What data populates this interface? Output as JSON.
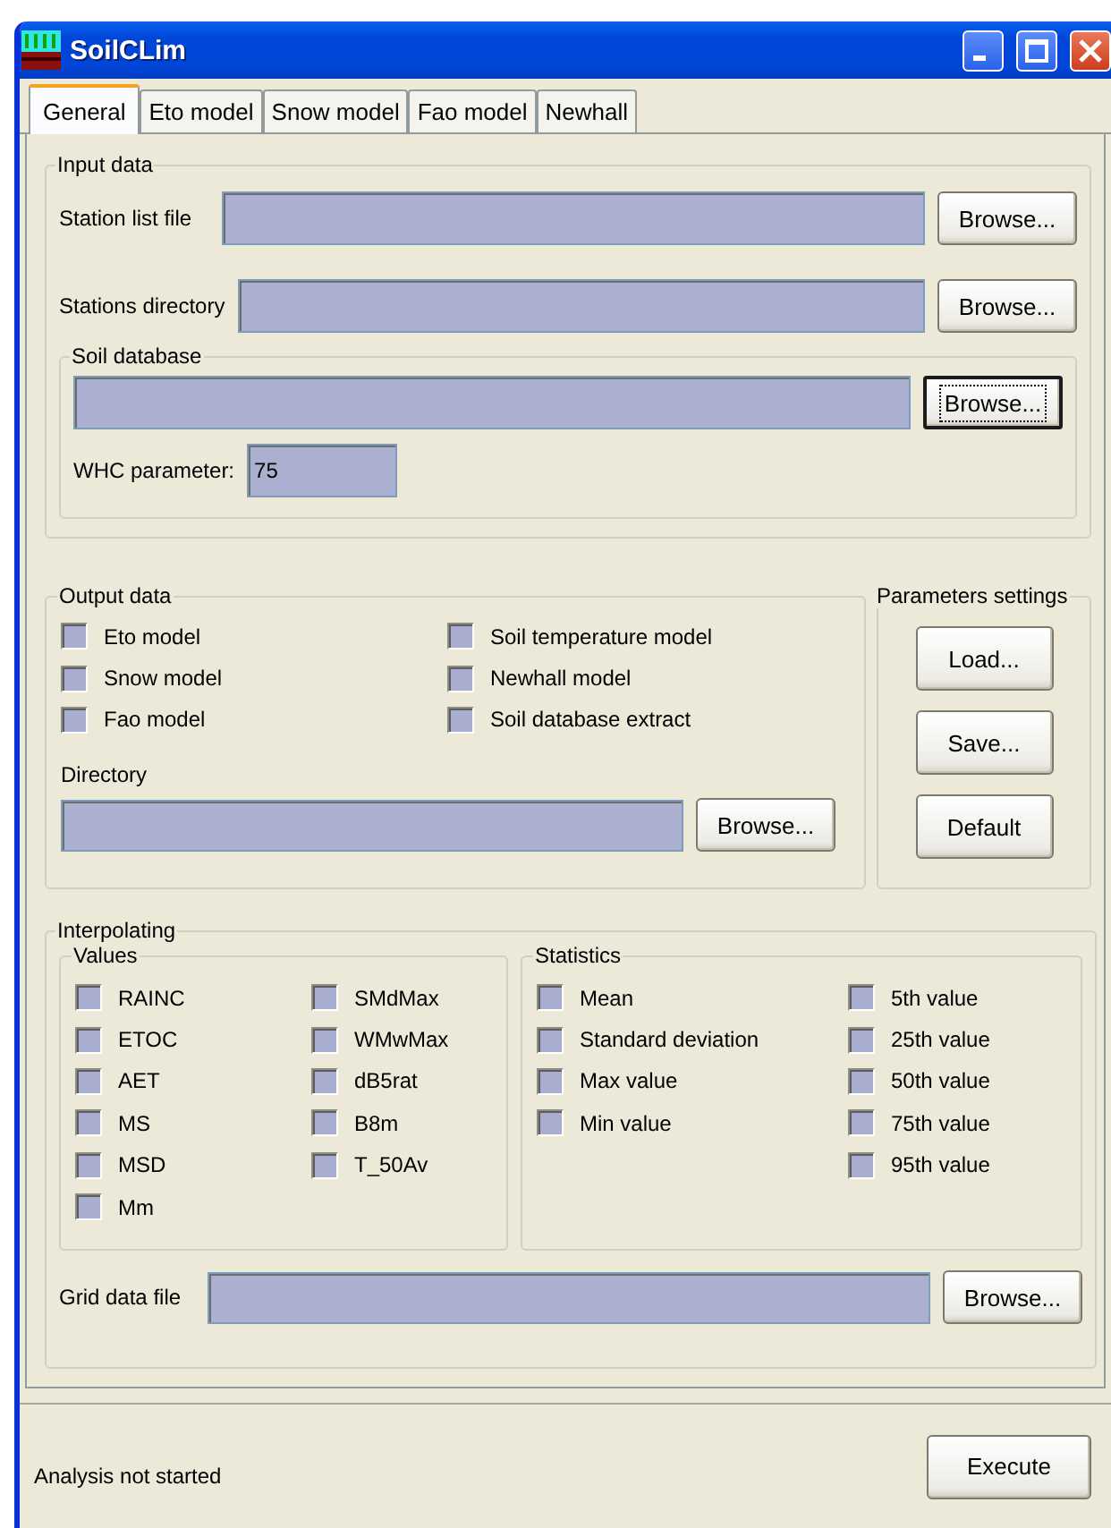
{
  "window": {
    "title": "SoilCLim"
  },
  "tabs": [
    {
      "label": "General",
      "selected": true
    },
    {
      "label": "Eto model",
      "selected": false
    },
    {
      "label": "Snow model",
      "selected": false
    },
    {
      "label": "Fao model",
      "selected": false
    },
    {
      "label": "Newhall",
      "selected": false
    }
  ],
  "input_data": {
    "title": "Input data",
    "station_list_file": {
      "label": "Station list file",
      "button": {
        "label": "Browse...",
        "focused": false
      }
    },
    "stations_directory": {
      "label": "Stations directory",
      "button": {
        "label": "Browse...",
        "focused": false
      }
    },
    "soil_database": {
      "title": "Soil database",
      "button": {
        "label": "Browse...",
        "focused": true
      },
      "whc_parameter": {
        "label": "WHC parameter:",
        "value": "75"
      }
    }
  },
  "output_data": {
    "title": "Output data",
    "options": [
      {
        "label": "Eto model",
        "checked": false
      },
      {
        "label": "Snow model",
        "checked": false
      },
      {
        "label": "Fao model",
        "checked": false
      },
      {
        "label": "Soil temperature model",
        "checked": false
      },
      {
        "label": "Newhall model",
        "checked": false
      },
      {
        "label": "Soil database extract",
        "checked": false
      }
    ],
    "directory": {
      "label": "Directory",
      "button": {
        "label": "Browse...",
        "focused": false
      }
    }
  },
  "parameters_settings": {
    "title": "Parameters settings",
    "buttons": [
      {
        "label": "Load...",
        "focused": false
      },
      {
        "label": "Save...",
        "focused": false
      },
      {
        "label": "Default",
        "focused": false
      }
    ]
  },
  "interpolating": {
    "title": "Interpolating",
    "values": {
      "title": "Values",
      "items": [
        {
          "label": "RAINC",
          "checked": false
        },
        {
          "label": "ETOC",
          "checked": false
        },
        {
          "label": "AET",
          "checked": false
        },
        {
          "label": "MS",
          "checked": false
        },
        {
          "label": "MSD",
          "checked": false
        },
        {
          "label": "Mm",
          "checked": false
        },
        {
          "label": "SMdMax",
          "checked": false
        },
        {
          "label": "WMwMax",
          "checked": false
        },
        {
          "label": "dB5rat",
          "checked": false
        },
        {
          "label": "B8m",
          "checked": false
        },
        {
          "label": "T_50Av",
          "checked": false
        }
      ]
    },
    "statistics": {
      "title": "Statistics",
      "items": [
        {
          "label": "Mean",
          "checked": false
        },
        {
          "label": "Standard deviation",
          "checked": false
        },
        {
          "label": "Max value",
          "checked": false
        },
        {
          "label": "Min value",
          "checked": false
        },
        {
          "label": "5th value",
          "checked": false
        },
        {
          "label": "25th value",
          "checked": false
        },
        {
          "label": "50th value",
          "checked": false
        },
        {
          "label": "75th value",
          "checked": false
        },
        {
          "label": "95th value",
          "checked": false
        }
      ]
    },
    "grid_data_file": {
      "label": "Grid data file",
      "button": {
        "label": "Browse...",
        "focused": false
      }
    }
  },
  "status_bar": {
    "text": "Analysis not started",
    "button": {
      "label": "Execute",
      "focused": false
    }
  }
}
